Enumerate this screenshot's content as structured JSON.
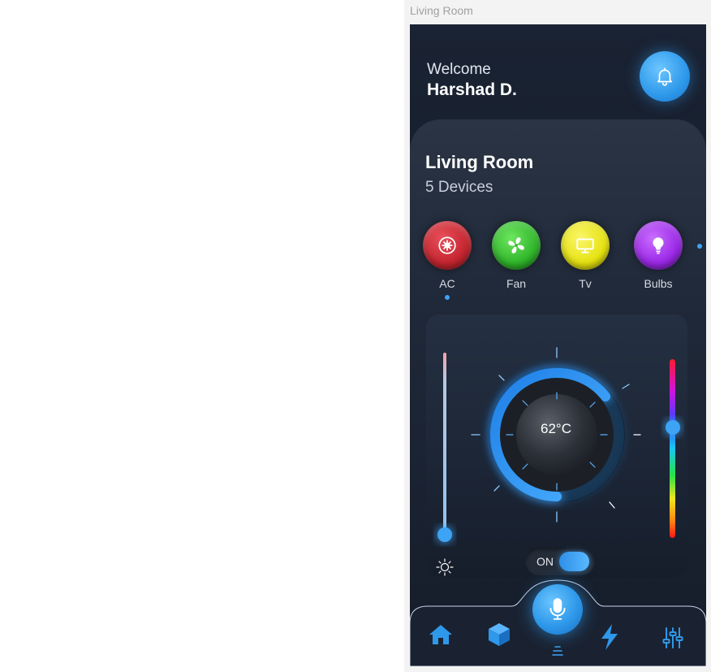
{
  "frame": {
    "title": "Living Room"
  },
  "header": {
    "welcome": "Welcome",
    "user_name": "Harshad D."
  },
  "room": {
    "name": "Living Room",
    "device_count": "5 Devices"
  },
  "devices": [
    {
      "label": "AC",
      "icon": "ac-icon",
      "color": "#c4252f",
      "selected": true
    },
    {
      "label": "Fan",
      "icon": "fan-icon",
      "color": "#2fb52a"
    },
    {
      "label": "Tv",
      "icon": "tv-icon",
      "color": "#e5e20f"
    },
    {
      "label": "Bulbs",
      "icon": "bulb-icon",
      "color": "#9a28e6"
    }
  ],
  "control": {
    "temperature": "62°C",
    "toggle_label": "ON",
    "power_on": true,
    "brightness_level": 0,
    "color_slider_level": 0.62
  },
  "nav": {
    "items": [
      "home-icon",
      "cube-icon",
      "mic-icon",
      "bolt-icon",
      "sliders-icon"
    ]
  },
  "colors": {
    "accent": "#2e98ea",
    "background": "#1a2333"
  }
}
